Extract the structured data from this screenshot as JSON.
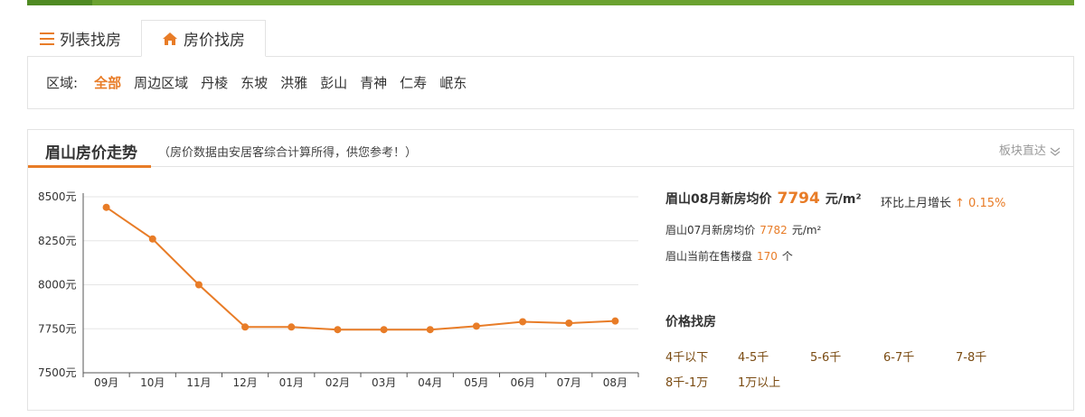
{
  "tabs": {
    "list_label": "列表找房",
    "price_label": "房价找房"
  },
  "filter": {
    "label": "区域:",
    "options": [
      "全部",
      "周边区域",
      "丹棱",
      "东坡",
      "洪雅",
      "彭山",
      "青神",
      "仁寿",
      "岷东"
    ],
    "active": "全部"
  },
  "trend": {
    "title": "眉山房价走势",
    "note": "（房价数据由安居客综合计算所得，供您参考！）",
    "more": "板块直达"
  },
  "stats": {
    "main_label": "眉山08月新房均价",
    "main_value": "7794",
    "main_unit": "元/m²",
    "change_label": "环比上月增长",
    "change_value": "↑ 0.15%",
    "prev_label": "眉山07月新房均价",
    "prev_value": "7782",
    "prev_unit": "元/m²",
    "onsale_label": "眉山当前在售楼盘",
    "onsale_value": "170",
    "onsale_unit": "个"
  },
  "price_finder": {
    "title": "价格找房",
    "options": [
      "4千以下",
      "4-5千",
      "5-6千",
      "6-7千",
      "7-8千",
      "8千-1万",
      "1万以上"
    ]
  },
  "colors": {
    "accent": "#e87c27",
    "top_bar": "#6ba230"
  },
  "chart_data": {
    "type": "line",
    "categories": [
      "09月",
      "10月",
      "11月",
      "12月",
      "01月",
      "02月",
      "03月",
      "04月",
      "05月",
      "06月",
      "07月",
      "08月"
    ],
    "values": [
      8440,
      8260,
      8000,
      7760,
      7760,
      7745,
      7745,
      7745,
      7765,
      7790,
      7782,
      7794
    ],
    "yticks": [
      7500,
      7750,
      8000,
      8250,
      8500
    ],
    "ytick_labels": [
      "7500元",
      "7750元",
      "8000元",
      "8250元",
      "8500元"
    ],
    "ylim": [
      7500,
      8500
    ],
    "grid": true
  }
}
